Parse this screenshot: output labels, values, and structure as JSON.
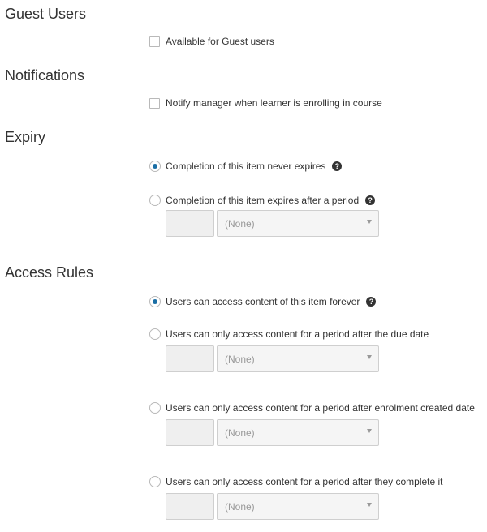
{
  "guest": {
    "title": "Guest Users",
    "available_label": "Available for Guest users"
  },
  "notifications": {
    "title": "Notifications",
    "notify_label": "Notify manager when learner is enrolling in course"
  },
  "expiry": {
    "title": "Expiry",
    "never_label": "Completion of this item never expires",
    "period_label": "Completion of this item expires after a period",
    "selected": "never",
    "period_select_value": "(None)",
    "period_number_value": ""
  },
  "access": {
    "title": "Access Rules",
    "forever_label": "Users can access content of this item forever",
    "due_date_label": "Users can only access content for a period after the due date",
    "enrolment_label": "Users can only access content for a period after enrolment created date",
    "complete_label": "Users can only access content for a period after they complete it",
    "selected": "forever",
    "due_select_value": "(None)",
    "enrolment_select_value": "(None)",
    "complete_select_value": "(None)"
  },
  "icons": {
    "help": "help-icon",
    "help_glyph": "?"
  },
  "colors": {
    "radio_selected": "#1a6ea5",
    "text": "#333333",
    "disabled_text": "#999999"
  }
}
